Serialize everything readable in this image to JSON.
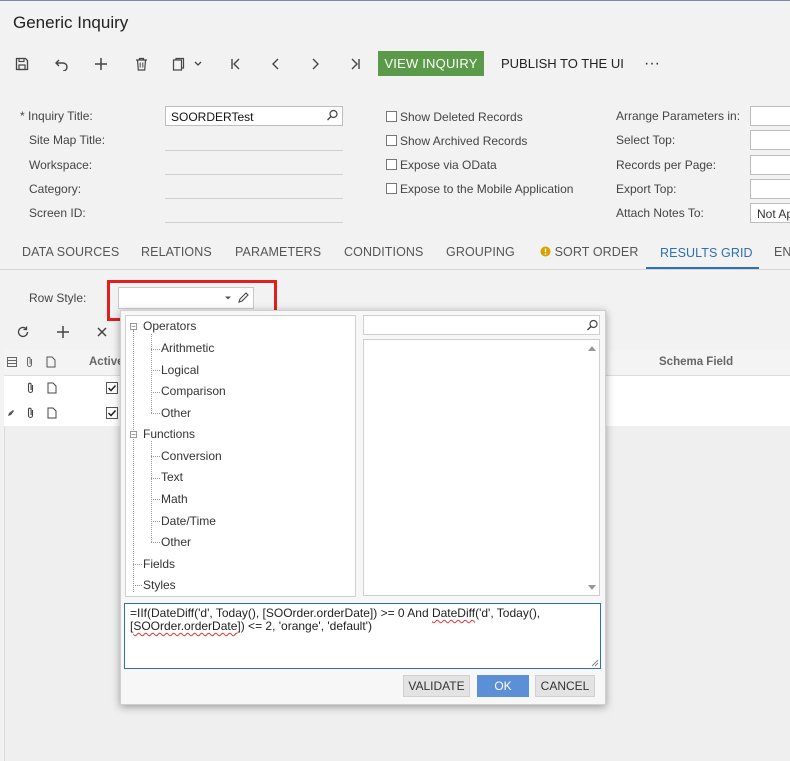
{
  "page": {
    "title": "Generic Inquiry"
  },
  "toolbar": {
    "view_inquiry": "VIEW INQUIRY",
    "publish": "PUBLISH TO THE UI",
    "more": "···"
  },
  "form": {
    "inquiry_title_label": "Inquiry Title:",
    "inquiry_title_value": "SOORDERTest",
    "required_mark": "*",
    "site_map_title_label": "Site Map Title:",
    "workspace_label": "Workspace:",
    "category_label": "Category:",
    "screen_id_label": "Screen ID:",
    "show_deleted": "Show Deleted Records",
    "show_archived": "Show Archived Records",
    "expose_odata": "Expose via OData",
    "expose_mobile": "Expose to the Mobile Application",
    "arrange_params": "Arrange Parameters in:",
    "select_top": "Select Top:",
    "records_per_page": "Records per Page:",
    "export_top": "Export Top:",
    "attach_notes": "Attach Notes To:",
    "attach_notes_value": "Not Ap"
  },
  "tabs": [
    {
      "label": "DATA SOURCES"
    },
    {
      "label": "RELATIONS"
    },
    {
      "label": "PARAMETERS"
    },
    {
      "label": "CONDITIONS"
    },
    {
      "label": "GROUPING"
    },
    {
      "label": "SORT ORDER"
    },
    {
      "label": "RESULTS GRID"
    },
    {
      "label": "EN"
    }
  ],
  "results": {
    "row_style_label": "Row Style:",
    "col_active": "Active",
    "col_schema_field": "Schema Field"
  },
  "editor": {
    "tree": {
      "operators": "Operators",
      "arithmetic": "Arithmetic",
      "logical": "Logical",
      "comparison": "Comparison",
      "other1": "Other",
      "functions": "Functions",
      "conversion": "Conversion",
      "text": "Text",
      "math": "Math",
      "datetime": "Date/Time",
      "other2": "Other",
      "fields": "Fields",
      "styles": "Styles"
    },
    "formula_p1": "=IIf(DateDiff('d', Today(), [SOOrder.orderDate]) >= 0 And ",
    "formula_squig1": "DateDiff",
    "formula_p2": "('d', Today(), ",
    "formula_p3": "[",
    "formula_squig2": "SOOrder.orderDate",
    "formula_p4": "]) <= 2, 'orange', 'default')",
    "validate": "VALIDATE",
    "ok": "OK",
    "cancel": "CANCEL"
  },
  "colors": {
    "accent": "#2f6fb3",
    "view_inquiry_bg": "#5b9a48",
    "ok_bg": "#5b8fd6",
    "highlight_border": "#e0201e"
  }
}
